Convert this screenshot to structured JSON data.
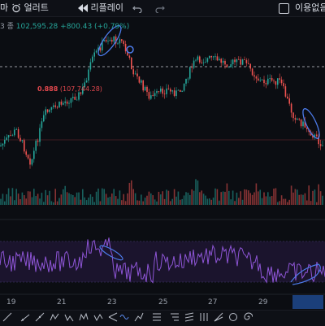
{
  "toolbar": {
    "alert_label": "얼러트",
    "replay_label": "리플레이",
    "right_label": "이용없음",
    "left_fragment": "마"
  },
  "price_info": {
    "prefix": "3 종",
    "price": "102,595.28",
    "change": "+800.43 (+0.79%)"
  },
  "fib": {
    "level": "0.888",
    "value": "(107,744.28)"
  },
  "x_axis": {
    "ticks": [
      "19",
      "21",
      "23",
      "25",
      "27",
      "29"
    ]
  },
  "bottom_toolbar": {
    "items": [
      "trend-line",
      "ray-1",
      "ray-2",
      "ab-cd",
      "ab-cd-2",
      "wz",
      "xyz",
      "pitchfork",
      "wave",
      "arrow-pattern",
      "fib-1",
      "fib-2",
      "fib-3",
      "fib-4",
      "fib-5",
      "fib-6",
      "fib-7"
    ]
  },
  "colors": {
    "up": "#26a69a",
    "down": "#ef5350",
    "rsi_line": "#8e55d6",
    "rsi_band": "#2a1b4a",
    "annotation": "#4c7bea"
  }
}
